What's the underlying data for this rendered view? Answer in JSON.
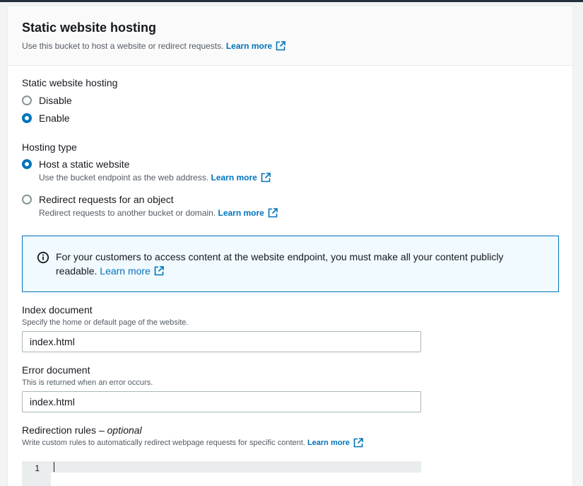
{
  "panel": {
    "title": "Static website hosting",
    "description": "Use this bucket to host a website or redirect requests.",
    "learn_more": "Learn more"
  },
  "static_hosting": {
    "label": "Static website hosting",
    "options": [
      {
        "label": "Disable",
        "selected": false
      },
      {
        "label": "Enable",
        "selected": true
      }
    ]
  },
  "hosting_type": {
    "label": "Hosting type",
    "options": [
      {
        "label": "Host a static website",
        "description": "Use the bucket endpoint as the web address.",
        "learn_more": "Learn more",
        "selected": true
      },
      {
        "label": "Redirect requests for an object",
        "description": "Redirect requests to another bucket or domain.",
        "learn_more": "Learn more",
        "selected": false
      }
    ]
  },
  "alert": {
    "text": "For your customers to access content at the website endpoint, you must make all your content publicly readable.",
    "learn_more": "Learn more"
  },
  "index_document": {
    "label": "Index document",
    "help": "Specify the home or default page of the website.",
    "value": "index.html"
  },
  "error_document": {
    "label": "Error document",
    "help": "This is returned when an error occurs.",
    "value": "index.html"
  },
  "redirection_rules": {
    "label": "Redirection rules –",
    "optional": "optional",
    "help": "Write custom rules to automatically redirect webpage requests for specific content.",
    "learn_more": "Learn more",
    "line_number": "1"
  },
  "colors": {
    "link": "#0073bb",
    "alert_bg": "#f1faff",
    "alert_border": "#0073bb"
  }
}
